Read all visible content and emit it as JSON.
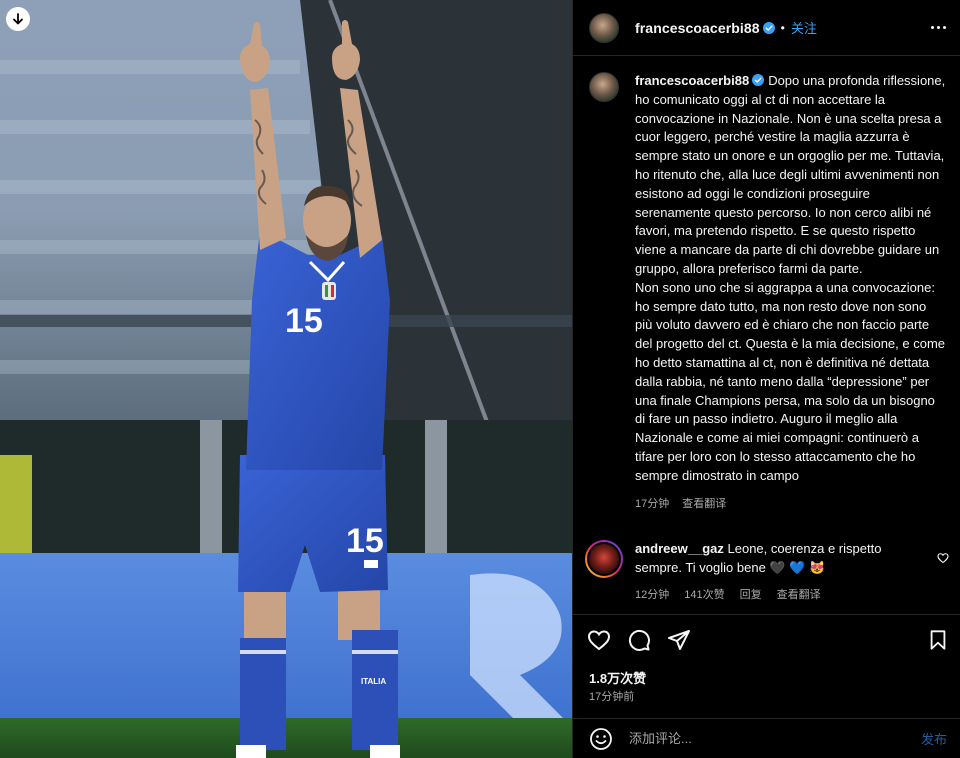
{
  "photo": {
    "alt_icon": "download-icon",
    "jersey_number": "15",
    "sock_text": "ITALIA"
  },
  "post": {
    "author": "francescoacerbi88",
    "follow_label": "关注",
    "dot": "•",
    "more_icon": "more-horizontal-icon",
    "verified_icon": "verified-badge-icon",
    "caption": "Dopo una profonda riflessione, ho comunicato oggi al ct di non accettare la convocazione in Nazionale. Non è una scelta presa a cuor leggero, perché vestire la maglia azzurra è sempre stato un onore e un orgoglio per me. Tuttavia, ho ritenuto che, alla luce degli ultimi avvenimenti non esistono ad oggi le condizioni proseguire serenamente questo percorso. Io non cerco alibi né favori, ma pretendo rispetto. E se questo rispetto viene a mancare da parte di chi dovrebbe guidare un gruppo, allora preferisco farmi da parte.\nNon sono uno che si aggrappa a una convocazione: ho sempre dato tutto, ma non resto dove non sono più voluto davvero ed è chiaro che non faccio parte del progetto del ct. Questa è la mia decisione, e come ho detto stamattina al ct, non è definitiva né dettata dalla rabbia, né tanto meno dalla “depressione” per una finale Champions persa, ma solo da un bisogno di fare un passo indietro. Auguro il meglio alla Nazionale e come ai miei compagni: continuerò a tifare per loro con lo stesso attaccamento che ho sempre dimostrato in campo",
    "caption_time": "17分钟",
    "translate_label": "查看翻译",
    "likes": "1.8万次赞",
    "posted_ago": "17分钟前"
  },
  "comment": {
    "author": "andreew__gaz",
    "text": "Leone, coerenza e rispetto sempre. Ti voglio bene",
    "emojis": "🖤 💙 😻",
    "time": "12分钟",
    "likes": "141次赞",
    "reply_label": "回复",
    "translate_label": "查看翻译"
  },
  "composer": {
    "placeholder": "添加评论...",
    "post_label": "发布"
  },
  "colors": {
    "accent": "#3aa0f5",
    "post_disabled": "#1f5f9c",
    "secondary_text": "#a8a8a8",
    "jersey_blue": "#2f56c8"
  }
}
